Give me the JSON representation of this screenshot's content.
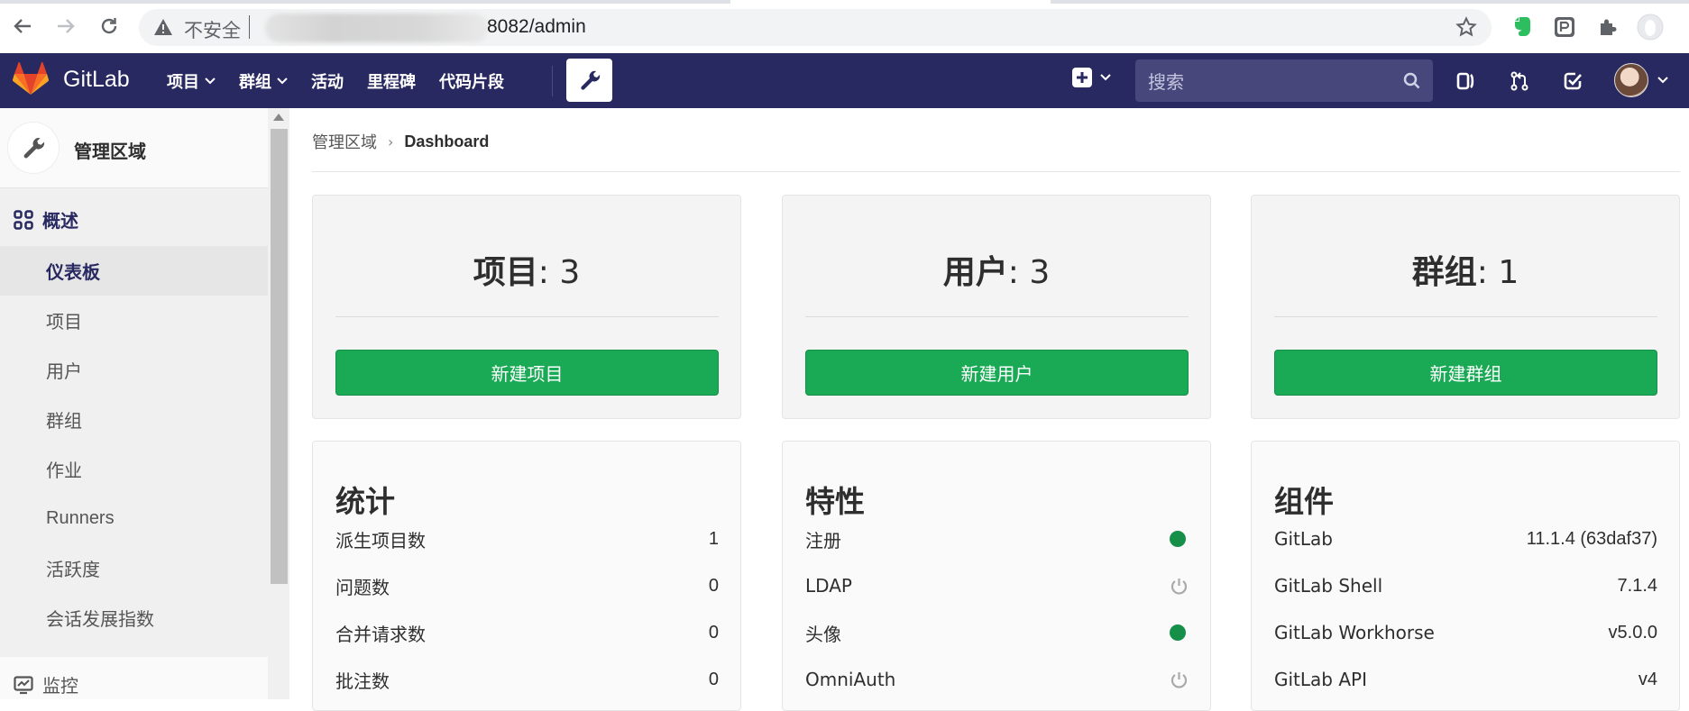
{
  "browser": {
    "insecure_label": "不安全",
    "url_suffix": "8082/admin"
  },
  "header": {
    "brand": "GitLab",
    "nav": [
      {
        "label": "项目"
      },
      {
        "label": "群组"
      },
      {
        "label": "活动"
      },
      {
        "label": "里程碑"
      },
      {
        "label": "代码片段"
      }
    ],
    "search_placeholder": "搜索"
  },
  "sidebar": {
    "context_title": "管理区域",
    "overview_label": "概述",
    "sub_items": [
      {
        "label": "仪表板",
        "active": true
      },
      {
        "label": "项目"
      },
      {
        "label": "用户"
      },
      {
        "label": "群组"
      },
      {
        "label": "作业"
      },
      {
        "label": "Runners"
      },
      {
        "label": "活跃度"
      },
      {
        "label": "会话发展指数"
      }
    ],
    "next_section": "监控"
  },
  "breadcrumb": {
    "parent": "管理区域",
    "current": "Dashboard"
  },
  "stats": [
    {
      "label": "项目",
      "value": ": 3",
      "button": "新建项目"
    },
    {
      "label": "用户",
      "value": ": 3",
      "button": "新建用户"
    },
    {
      "label": "群组",
      "value": ": 1",
      "button": "新建群组"
    }
  ],
  "statistics": {
    "title": "统计",
    "rows": [
      {
        "k": "派生项目数",
        "v": "1"
      },
      {
        "k": "问题数",
        "v": "0"
      },
      {
        "k": "合并请求数",
        "v": "0"
      },
      {
        "k": "批注数",
        "v": "0"
      }
    ]
  },
  "features": {
    "title": "特性",
    "rows": [
      {
        "k": "注册",
        "state": "on"
      },
      {
        "k": "LDAP",
        "state": "off"
      },
      {
        "k": "头像",
        "state": "on"
      },
      {
        "k": "OmniAuth",
        "state": "off"
      }
    ]
  },
  "components": {
    "title": "组件",
    "rows": [
      {
        "k": "GitLab",
        "v": "11.1.4 (63daf37)"
      },
      {
        "k": "GitLab Shell",
        "v": "7.1.4"
      },
      {
        "k": "GitLab Workhorse",
        "v": "v5.0.0"
      },
      {
        "k": "GitLab API",
        "v": "v4"
      }
    ]
  },
  "colors": {
    "header_bg": "#292961",
    "success_green": "#1aaa55",
    "feature_on": "#168f48"
  }
}
